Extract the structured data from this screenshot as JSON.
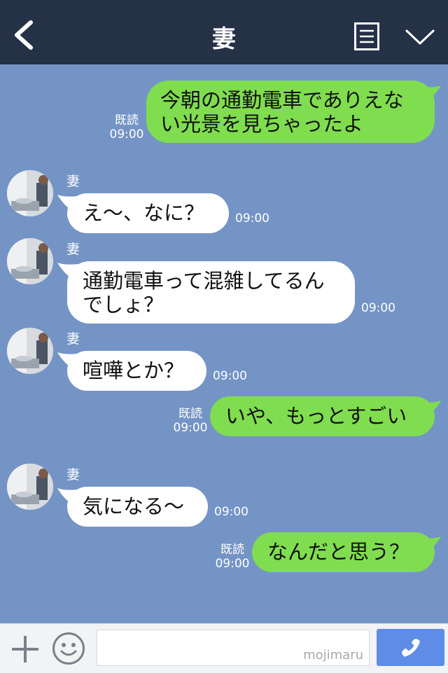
{
  "header": {
    "title": "妻"
  },
  "messages": [
    {
      "dir": "out",
      "lines": [
        "今朝の通勤電車でありえな",
        "い光景を見ちゃったよ"
      ],
      "read": "既読",
      "time": "09:00"
    },
    {
      "dir": "in",
      "sender": "妻",
      "lines": [
        "え～、なに？"
      ],
      "time": "09:00"
    },
    {
      "dir": "in",
      "sender": "妻",
      "lines": [
        "通勤電車って混雑してるん",
        "でしょ？"
      ],
      "time": "09:00"
    },
    {
      "dir": "in",
      "sender": "妻",
      "lines": [
        "喧嘩とか？"
      ],
      "time": "09:00"
    },
    {
      "dir": "out",
      "lines": [
        "いや、もっとすごい"
      ],
      "read": "既読",
      "time": "09:00"
    },
    {
      "dir": "in",
      "sender": "妻",
      "lines": [
        "気になる～"
      ],
      "time": "09:00"
    },
    {
      "dir": "out",
      "lines": [
        "なんだと思う？"
      ],
      "read": "既読",
      "time": "09:00"
    }
  ],
  "footer": {
    "watermark": "mojimaru"
  },
  "icons": {
    "back": "chevron-left-icon",
    "memo": "note-icon",
    "menu": "chevron-down-icon",
    "add": "plus-icon",
    "emoji": "smile-icon",
    "call": "phone-icon"
  },
  "colors": {
    "header": "#253147",
    "background": "#7494c5",
    "outgoing_bubble": "#80dd4f",
    "incoming_bubble": "#ffffff",
    "call_button": "#5e8ce6"
  }
}
